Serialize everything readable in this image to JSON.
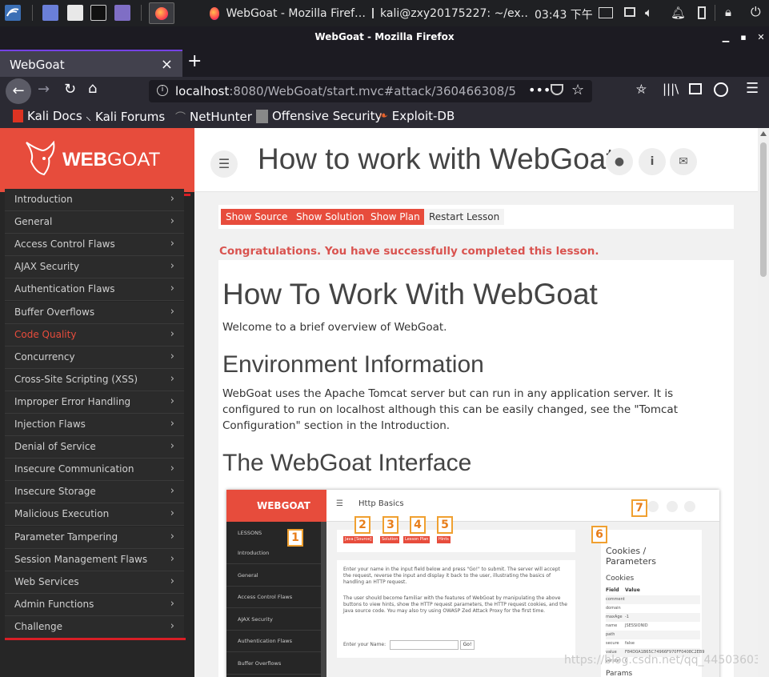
{
  "taskbar": {
    "tasks": [
      {
        "label": "WebGoat - Mozilla Firef…"
      },
      {
        "label": "kali@zxy20175227: ~/ex…"
      }
    ],
    "clock": "03:43 下午"
  },
  "window": {
    "title": "WebGoat - Mozilla Firefox"
  },
  "tab": {
    "label": "WebGoat",
    "close": "×",
    "new": "+"
  },
  "url": {
    "host": "localhost",
    "rest": ":8080/WebGoat/start.mvc#attack/360466308/5"
  },
  "bookmarks": [
    "Kali Docs",
    "Kali Forums",
    "NetHunter",
    "Offensive Security",
    "Exploit-DB"
  ],
  "app": {
    "logo": {
      "prefix": "WEB",
      "suffix": "GOAT"
    },
    "title": "How to work with WebGoat",
    "sidebar": [
      {
        "label": "Introduction"
      },
      {
        "label": "General"
      },
      {
        "label": "Access Control Flaws"
      },
      {
        "label": "AJAX Security"
      },
      {
        "label": "Authentication Flaws"
      },
      {
        "label": "Buffer Overflows"
      },
      {
        "label": "Code Quality",
        "active": true
      },
      {
        "label": "Concurrency"
      },
      {
        "label": "Cross-Site Scripting (XSS)"
      },
      {
        "label": "Improper Error Handling"
      },
      {
        "label": "Injection Flaws"
      },
      {
        "label": "Denial of Service"
      },
      {
        "label": "Insecure Communication"
      },
      {
        "label": "Insecure Storage"
      },
      {
        "label": "Malicious Execution"
      },
      {
        "label": "Parameter Tampering"
      },
      {
        "label": "Session Management Flaws"
      },
      {
        "label": "Web Services"
      },
      {
        "label": "Admin Functions"
      },
      {
        "label": "Challenge"
      }
    ],
    "buttons": {
      "source": "Show Source",
      "solution": "Show Solution",
      "plan": "Show Plan",
      "restart": "Restart Lesson"
    },
    "congrats": "Congratulations. You have successfully completed this lesson.",
    "lesson": {
      "h1": "How To Work With WebGoat",
      "intro": "Welcome to a brief overview of WebGoat.",
      "env_heading": "Environment Information",
      "env_text": "WebGoat uses the Apache Tomcat server but can run in any application server. It is configured to run on localhost although this can be easily changed, see the \"Tomcat Configuration\" section in the Introduction.",
      "interface_heading": "The WebGoat Interface"
    },
    "screenshot": {
      "logo": "WEBGOAT",
      "title": "Http Basics",
      "lessons": "LESSONS",
      "side": [
        "Introduction",
        "General",
        "Access Control Flaws",
        "AJAX Security",
        "Authentication Flaws",
        "Buffer Overflows"
      ],
      "buttons": [
        "Java [Source]",
        "Solution",
        "Lesson Plan",
        "Hints"
      ],
      "numbers": [
        "1",
        "2",
        "3",
        "4",
        "5",
        "6",
        "7"
      ],
      "para1": "Enter your name in the input field below and press \"Go!\" to submit. The server will accept the request, reverse the input and display it back to the user, illustrating the basics of handling an HTTP request.",
      "para2": "The user should become familiar with the features of WebGoat by manipulating the above buttons to view hints, show the HTTP request parameters, the HTTP request cookies, and the Java source code. You may also try using OWASP Zed Attack Proxy for the first time.",
      "name_label": "Enter your Name:",
      "go": "Go!",
      "cookies_title": "Cookies / Parameters",
      "cookies_sub": "Cookies",
      "field_hdr": "Field",
      "value_hdr": "Value",
      "cookie_rows": [
        [
          "comment",
          ""
        ],
        [
          "domain",
          ""
        ],
        [
          "maxAge",
          "-1"
        ],
        [
          "name",
          "JSESSIONID"
        ],
        [
          "path",
          ""
        ],
        [
          "secure",
          "false"
        ],
        [
          "value",
          "F84D0A1B65C74966F970FF0408C2EB9"
        ],
        [
          "version",
          "0"
        ]
      ],
      "params": "Params"
    }
  },
  "watermark": "https://blog.csdn.net/qq_44503603",
  "colors": {
    "brand": "#e74c3c",
    "sidebar": "#262626",
    "highlight": "#f0a030"
  }
}
